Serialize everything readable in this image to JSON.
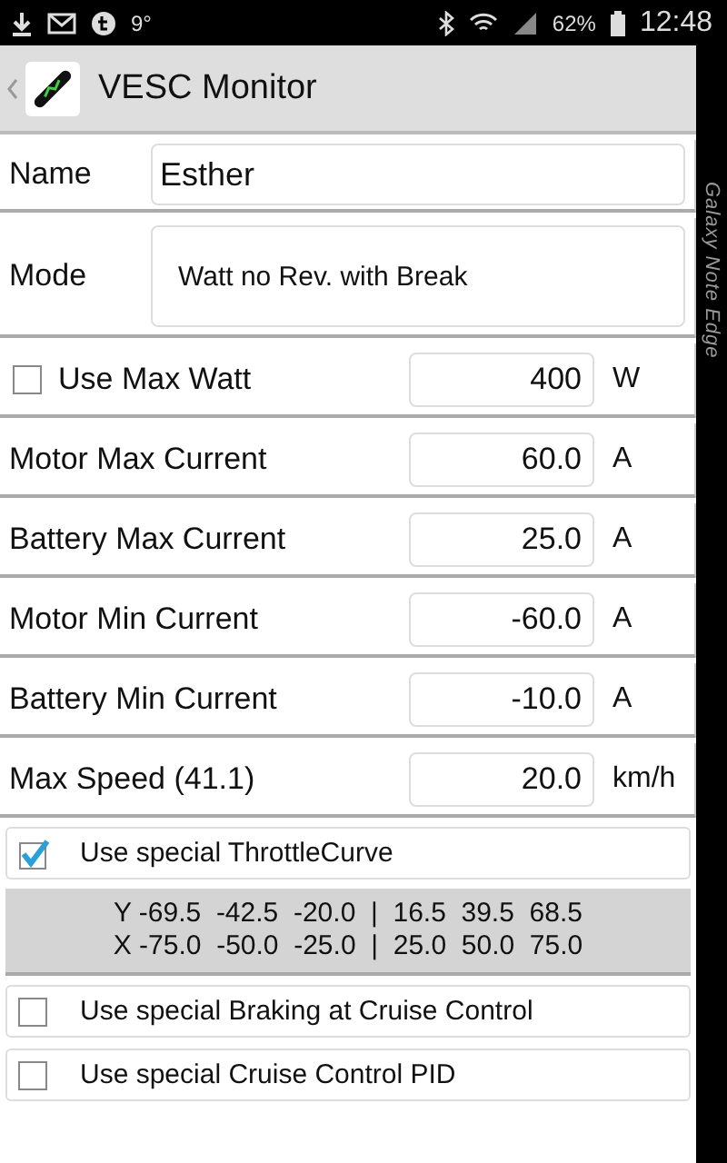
{
  "status_bar": {
    "temperature": "9°",
    "battery": "62%",
    "time": "12:48"
  },
  "app_bar": {
    "title": "VESC Monitor"
  },
  "name_field": {
    "label": "Name",
    "value": "Esther"
  },
  "mode_field": {
    "label": "Mode",
    "value": "Watt no Rev. with Break"
  },
  "settings": [
    {
      "kind": "checkbox",
      "label": "Use Max Watt",
      "checked": false,
      "value": "400",
      "unit": "W"
    },
    {
      "kind": "plain",
      "label": "Motor Max Current",
      "value": "60.0",
      "unit": "A"
    },
    {
      "kind": "plain",
      "label": "Battery Max Current",
      "value": "25.0",
      "unit": "A"
    },
    {
      "kind": "plain",
      "label": "Motor Min Current",
      "value": "-60.0",
      "unit": "A"
    },
    {
      "kind": "plain",
      "label": "Battery Min Current",
      "value": "-10.0",
      "unit": "A"
    },
    {
      "kind": "plain",
      "label": "Max Speed (41.1)",
      "value": "20.0",
      "unit": "km/h"
    }
  ],
  "throttle_option": {
    "label": "Use special ThrottleCurve",
    "checked": true
  },
  "curve_lines": [
    "Y -69.5  -42.5  -20.0  |  16.5  39.5  68.5",
    "X -75.0  -50.0  -25.0  |  25.0  50.0  75.0"
  ],
  "options": [
    {
      "label": "Use special Braking at Cruise Control",
      "checked": false
    },
    {
      "label": "Use special Cruise Control PID",
      "checked": false
    }
  ],
  "edge_label": "Galaxy Note Edge"
}
